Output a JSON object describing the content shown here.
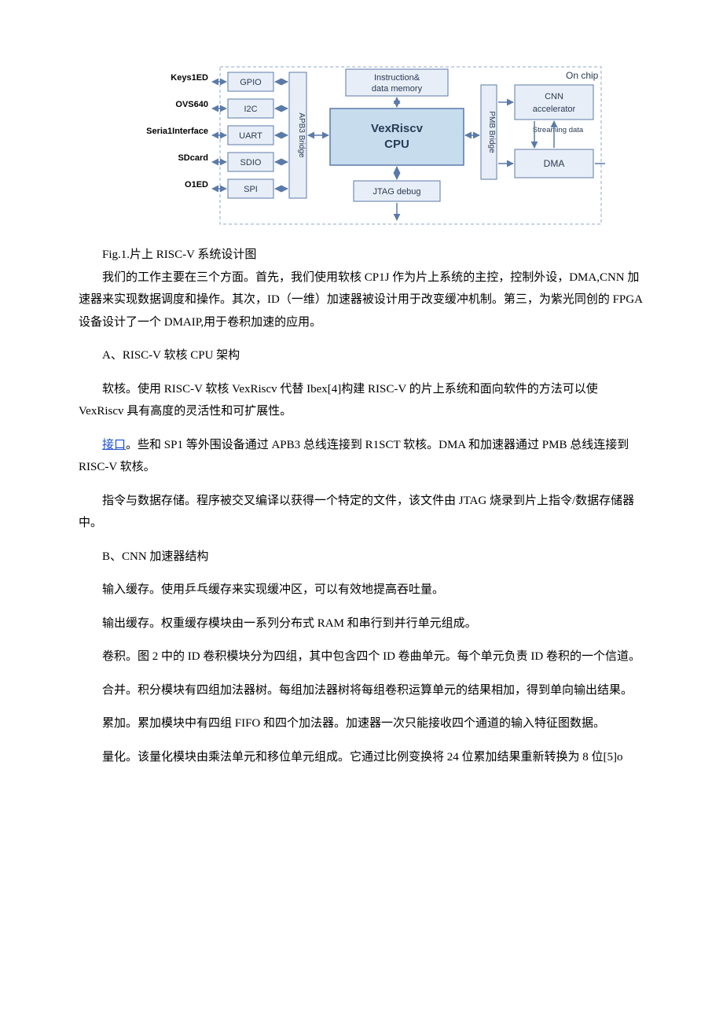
{
  "diagram": {
    "leftLabels": [
      "Keys1ED",
      "OVS640",
      "Seria1Interface",
      "SDcard",
      "O1ED"
    ],
    "periph": [
      "GPIO",
      "I2C",
      "UART",
      "SDIO",
      "SPI"
    ],
    "bridge1": "APB3 Bridge",
    "mem": "Instruction& data memory",
    "cpu": "VexRiscv CPU",
    "jtag": "JTAG debug",
    "bridge2": "PMB Bridge",
    "cnn": "CNN accelerator",
    "dma": "DMA",
    "stream": "Streaming data",
    "onchip": "On chip"
  },
  "caption": "Fig.1.片上 RISC-V 系统设计图",
  "p_intro": "我们的工作主要在三个方面。首先，我们使用软核 CP1J 作为片上系统的主控，控制外设，DMA,CNN 加速器来实现数据调度和操作。其次，ID（一维）加速器被设计用于改变缓冲机制。第三，为紫光同创的 FPGA 设备设计了一个 DMAIP,用于卷积加速的应用。",
  "secA": "A、RISC-V 软核 CPU 架构",
  "pA1": "软核。使用 RISC-V 软核 VexRiscv 代替 Ibex[4]构建 RISC-V 的片上系统和面向软件的方法可以使 VexRiscv 具有高度的灵活性和可扩展性。",
  "pA2_link": "接口",
  "pA2_rest": "。些和 SP1 等外围设备通过 APB3 总线连接到 R1SCT 软核。DMA 和加速器通过 PMB 总线连接到 RISC-V 软核。",
  "pA3": "指令与数据存储。程序被交叉编译以获得一个特定的文件，该文件由 JTAG 烧录到片上指令/数据存储器中。",
  "secB": "B、CNN 加速器结构",
  "pB1": "输入缓存。使用乒乓缓存来实现缓冲区，可以有效地提高吞吐量。",
  "pB2": "输出缓存。权重缓存模块由一系列分布式 RAM 和串行到并行单元组成。",
  "pB3": "卷积。图 2 中的 ID 卷积模块分为四组，其中包含四个 ID 卷曲单元。每个单元负责 ID 卷积的一个信道。",
  "pB4": "合并。积分模块有四组加法器树。每组加法器树将每组卷积运算单元的结果相加，得到单向输出结果。",
  "pB5": "累加。累加模块中有四组 FIFO 和四个加法器。加速器一次只能接收四个通道的输入特征图数据。",
  "pB6": "量化。该量化模块由乘法单元和移位单元组成。它通过比例变换将 24 位累加结果重新转换为 8 位[5]o"
}
